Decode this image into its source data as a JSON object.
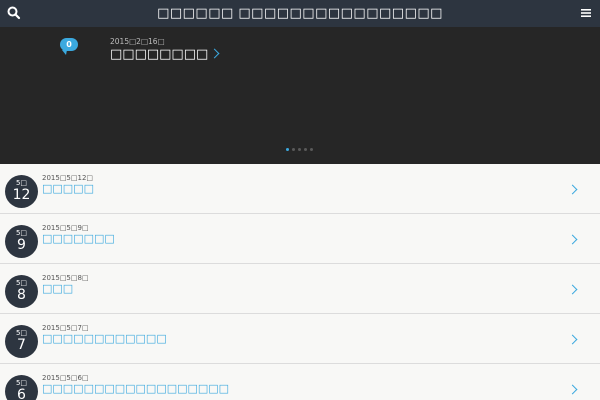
{
  "header": {
    "site_title": "□□□□□□ □□□□□□□□□□□□□□□□",
    "search_icon": "search-icon",
    "menu_icon": "hamburger-menu-icon"
  },
  "hero": {
    "comment_count": "0",
    "date": "2015□2□16□",
    "title": "□□□□□□□□",
    "slide_count": 5,
    "active_slide": 1
  },
  "posts": [
    {
      "month": "5□",
      "day": "12",
      "date": "2015□5□12□",
      "title": "□□□□□"
    },
    {
      "month": "5□",
      "day": "9",
      "date": "2015□5□9□",
      "title": "□□□□□□□"
    },
    {
      "month": "5□",
      "day": "8",
      "date": "2015□5□8□",
      "title": "□□□"
    },
    {
      "month": "5□",
      "day": "7",
      "date": "2015□5□7□",
      "title": "□□□□□□□□□□□□"
    },
    {
      "month": "5□",
      "day": "6",
      "date": "2015□5□6□",
      "title": "□□□□□□□□□□□□□□□□□□"
    }
  ],
  "colors": {
    "header_bg": "#2d3540",
    "hero_bg": "#262626",
    "accent": "#3ba9df",
    "page_bg": "#f8f8f6"
  }
}
